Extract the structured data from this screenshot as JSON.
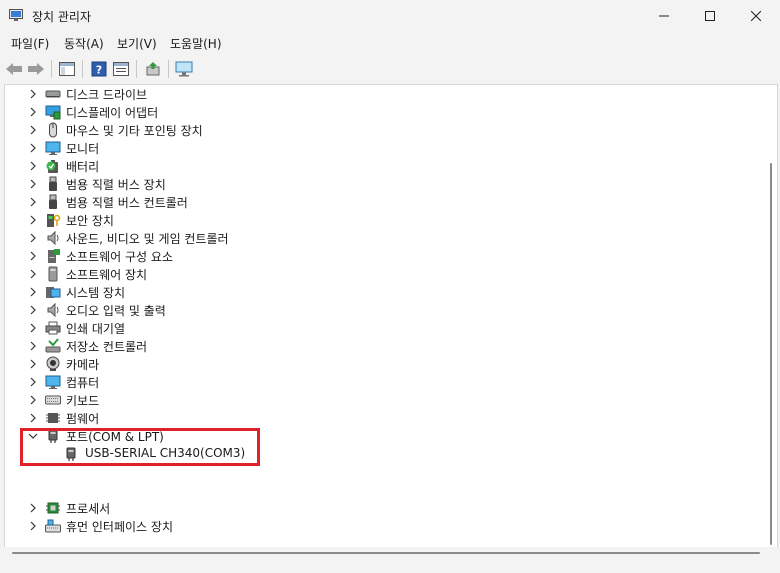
{
  "window": {
    "title": "장치 관리자"
  },
  "menu": [
    "파일(F)",
    "동작(A)",
    "보기(V)",
    "도움말(H)"
  ],
  "tree": {
    "nodes": [
      {
        "label": "디스크 드라이브",
        "icon": "disk-drive-icon",
        "expanded": false
      },
      {
        "label": "디스플레이 어댑터",
        "icon": "display-adapter-icon",
        "expanded": false
      },
      {
        "label": "마우스 및 기타 포인팅 장치",
        "icon": "mouse-icon",
        "expanded": false
      },
      {
        "label": "모니터",
        "icon": "monitor-icon",
        "expanded": false
      },
      {
        "label": "배터리",
        "icon": "battery-icon",
        "expanded": false
      },
      {
        "label": "범용 직렬 버스 장치",
        "icon": "usb-icon",
        "expanded": false
      },
      {
        "label": "범용 직렬 버스 컨트롤러",
        "icon": "usb-icon",
        "expanded": false
      },
      {
        "label": "보안 장치",
        "icon": "security-device-icon",
        "expanded": false
      },
      {
        "label": "사운드, 비디오 및 게임 컨트롤러",
        "icon": "speaker-icon",
        "expanded": false
      },
      {
        "label": "소프트웨어 구성 요소",
        "icon": "software-component-icon",
        "expanded": false
      },
      {
        "label": "소프트웨어 장치",
        "icon": "software-device-icon",
        "expanded": false
      },
      {
        "label": "시스템 장치",
        "icon": "system-device-icon",
        "expanded": false
      },
      {
        "label": "오디오 입력 및 출력",
        "icon": "speaker-icon",
        "expanded": false
      },
      {
        "label": "인쇄 대기열",
        "icon": "printer-icon",
        "expanded": false
      },
      {
        "label": "저장소 컨트롤러",
        "icon": "storage-controller-icon",
        "expanded": false
      },
      {
        "label": "카메라",
        "icon": "camera-icon",
        "expanded": false
      },
      {
        "label": "컴퓨터",
        "icon": "computer-icon",
        "expanded": false
      },
      {
        "label": "키보드",
        "icon": "keyboard-icon",
        "expanded": false
      },
      {
        "label": "펌웨어",
        "icon": "firmware-icon",
        "expanded": false
      },
      {
        "label": "포트(COM & LPT)",
        "icon": "port-icon",
        "expanded": true,
        "children": [
          {
            "label": "USB-SERIAL CH340(COM3)",
            "icon": "port-icon"
          }
        ]
      },
      {
        "label": "프로세서",
        "icon": "processor-icon",
        "expanded": false
      },
      {
        "label": "휴먼 인터페이스 장치",
        "icon": "hid-icon",
        "expanded": false
      }
    ]
  },
  "colors": {
    "highlight_border": "#e02127",
    "accent": "#1e74c9"
  }
}
